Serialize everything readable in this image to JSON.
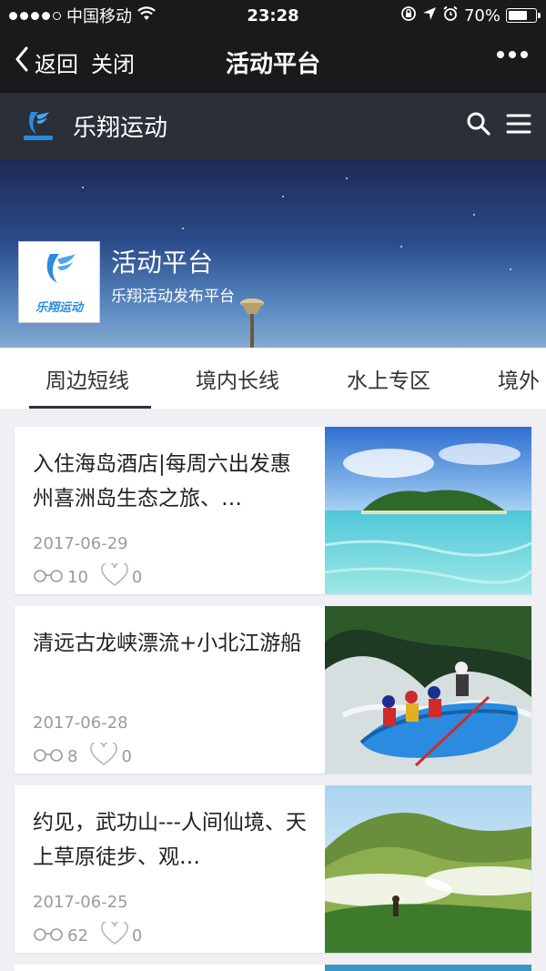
{
  "status_bar": {
    "carrier": "中国移动",
    "time": "23:28",
    "battery": "70%",
    "battery_level": 0.7
  },
  "nav": {
    "back_label": "返回",
    "close_label": "关闭",
    "title": "活动平台"
  },
  "brand": {
    "name": "乐翔运动"
  },
  "hero": {
    "title": "活动平台",
    "subtitle": "乐翔活动发布平台",
    "logo_text": "乐翔运动"
  },
  "tabs": [
    {
      "label": "周边短线",
      "active": true
    },
    {
      "label": "境内长线",
      "active": false
    },
    {
      "label": "水上专区",
      "active": false
    },
    {
      "label": "境外",
      "active": false
    }
  ],
  "articles": [
    {
      "title": "入住海岛酒店|每周六出发惠州喜洲岛生态之旅、…",
      "date": "2017-06-29",
      "views": "10",
      "likes": "0",
      "image": "island-photo"
    },
    {
      "title": "清远古龙峡漂流+小北江游船",
      "date": "2017-06-28",
      "views": "8",
      "likes": "0",
      "image": "rafting-photo"
    },
    {
      "title": "约见，武功山---人间仙境、天上草原徒步、观…",
      "date": "2017-06-25",
      "views": "62",
      "likes": "0",
      "image": "mountain-photo"
    }
  ],
  "colors": {
    "nav_bg": "#1a1a1c",
    "brand_bg": "#2b3038",
    "accent": "#2b3038"
  }
}
